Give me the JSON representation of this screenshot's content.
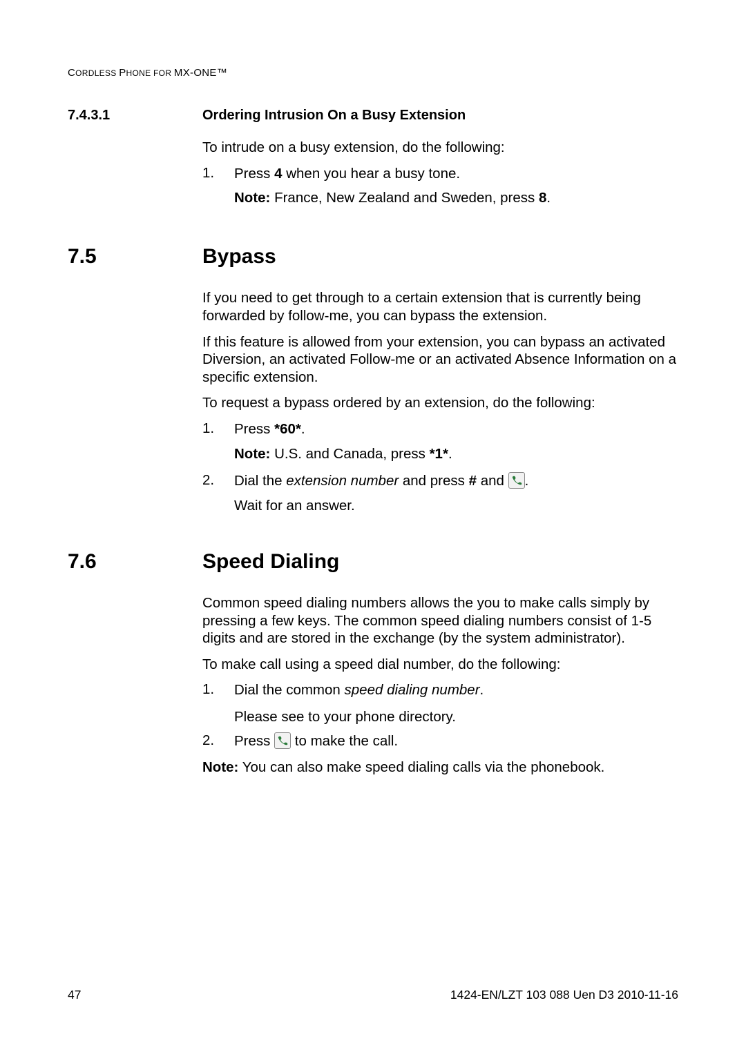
{
  "header": {
    "prefix": "C",
    "w1": "ORDLESS ",
    "pcap": "P",
    "w2": "HONE FOR ",
    "suffix": "MX-ONE™"
  },
  "s7431": {
    "num": "7.4.3.1",
    "title": "Ordering Intrusion On a Busy Extension",
    "intro": "To intrude on a busy extension, do the following:",
    "li1_num": "1.",
    "li1_a": "Press ",
    "li1_b": "4",
    "li1_c": " when you hear a busy tone.",
    "note_label": "Note:",
    "note_a": "  France, New Zealand and Sweden, press ",
    "note_b": "8",
    "note_c": "."
  },
  "s75": {
    "num": "7.5",
    "title": "Bypass",
    "p1": "If you need to get through to a certain extension that is currently being forwarded by follow-me, you can bypass the extension.",
    "p2": "If this feature is allowed from your extension, you can bypass an activated Diversion, an activated Follow-me or an activated Absence Information on a specific extension.",
    "p3": "To request a bypass ordered by an extension, do the following:",
    "li1_num": "1.",
    "li1_a": "Press ",
    "li1_b": "*60*",
    "li1_c": ".",
    "note1_label": "Note:",
    "note1_a": "  U.S. and Canada, press ",
    "note1_b": "*1*",
    "note1_c": ".",
    "li2_num": "2.",
    "li2_a": "Dial the ",
    "li2_b": "extension number",
    "li2_c": " and press ",
    "li2_d": "#",
    "li2_e": " and ",
    "li2_f": ".",
    "li2_wait": "Wait for an answer."
  },
  "s76": {
    "num": "7.6",
    "title": "Speed Dialing",
    "p1": "Common speed dialing numbers allows the you to make calls simply by pressing a few keys. The common speed dialing numbers consist of 1-5 digits and are stored in the exchange (by the system administrator).",
    "p2": "To make call using a speed dial number, do the following:",
    "li1_num": "1.",
    "li1_a": "Dial the common ",
    "li1_b": "speed dialing number",
    "li1_c": ".",
    "li1_sub": "Please see to your phone directory.",
    "li2_num": "2.",
    "li2_a": "Press ",
    "li2_b": " to make the call.",
    "note_label": "Note:",
    "note_text": "  You can also make speed dialing calls via the phonebook."
  },
  "footer": {
    "page": "47",
    "docid": "1424-EN/LZT 103 088 Uen D3 2010-11-16"
  }
}
